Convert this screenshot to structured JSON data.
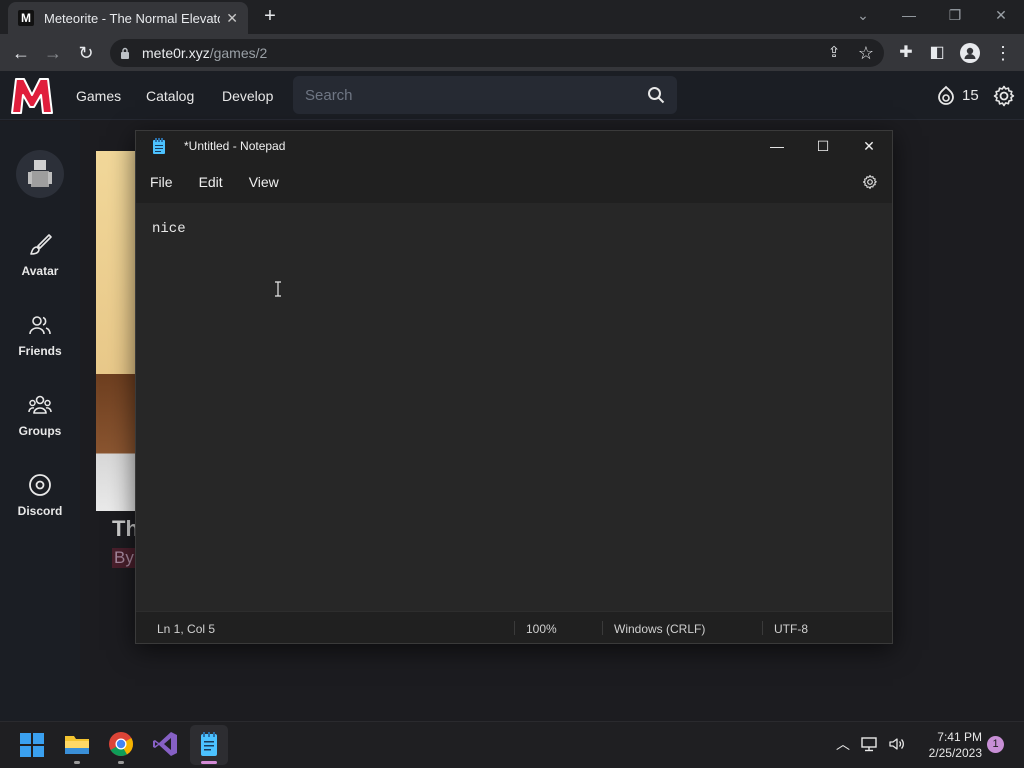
{
  "browser": {
    "tab_title": "Meteorite - The Normal Elevator",
    "tab_favicon": "M",
    "url_domain": "mete0r.xyz",
    "url_path": "/games/2"
  },
  "site": {
    "logo": "M",
    "nav": [
      "Games",
      "Catalog",
      "Develop"
    ],
    "search_placeholder": "Search",
    "currency_count": "15",
    "sidebar": [
      {
        "label": "Avatar",
        "icon": "brush-icon"
      },
      {
        "label": "Friends",
        "icon": "friends-icon"
      },
      {
        "label": "Groups",
        "icon": "groups-icon"
      },
      {
        "label": "Discord",
        "icon": "discord-icon"
      }
    ],
    "game_title_partial": "Th",
    "game_by_partial": "By"
  },
  "notepad": {
    "title": "*Untitled - Notepad",
    "menu": [
      "File",
      "Edit",
      "View"
    ],
    "content": "nice",
    "status": {
      "position": "Ln 1, Col 5",
      "zoom": "100%",
      "line_ending": "Windows (CRLF)",
      "encoding": "UTF-8"
    }
  },
  "taskbar": {
    "time": "7:41 PM",
    "date": "2/25/2023",
    "notification_count": "1"
  },
  "colors": {
    "site_accent": "#e01e3c",
    "site_bg": "#1b1e24",
    "notepad_bg": "#272727"
  }
}
